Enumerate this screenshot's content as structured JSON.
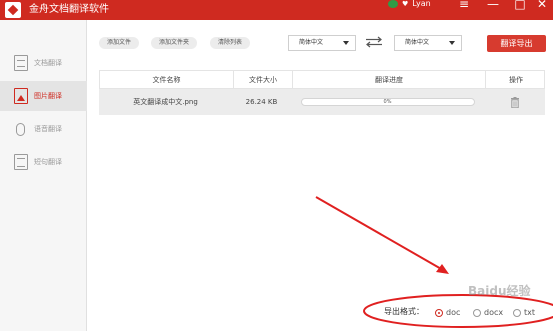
{
  "titlebar": {
    "app_title": "金舟文档翻译软件",
    "user_name": "Lyan",
    "menu_icon": "menu-icon",
    "minimize_icon": "minimize-icon",
    "maximize_icon": "maximize-icon",
    "close_icon": "close-icon",
    "brand_color": "#cf2a20"
  },
  "sidebar": {
    "items": [
      {
        "label": "文档翻译",
        "icon": "document-icon",
        "active": false
      },
      {
        "label": "图片翻译",
        "icon": "image-icon",
        "active": true
      },
      {
        "label": "语音翻译",
        "icon": "microphone-icon",
        "active": false
      },
      {
        "label": "短句翻译",
        "icon": "short-text-icon",
        "active": false
      }
    ]
  },
  "toolbar": {
    "add_file": "添加文件",
    "add_folder": "添加文件夹",
    "clear_list": "清除列表",
    "source_lang": "简体中文",
    "target_lang": "简体中文",
    "swap_icon": "swap-arrows-icon",
    "export_button": "翻译导出"
  },
  "table": {
    "headers": [
      "文件名称",
      "文件大小",
      "翻译进度",
      "操作"
    ],
    "rows": [
      {
        "name": "英文翻译成中文.png",
        "size": "26.24 KB",
        "progress": "0%",
        "progress_value": 0,
        "action_icon": "trash-icon"
      }
    ]
  },
  "export_format": {
    "label": "导出格式：",
    "options": [
      {
        "label": "doc",
        "checked": true
      },
      {
        "label": "docx",
        "checked": false
      },
      {
        "label": "txt",
        "checked": false
      }
    ]
  },
  "annotation": {
    "color": "#e02020",
    "watermark": "Baidu经验"
  }
}
